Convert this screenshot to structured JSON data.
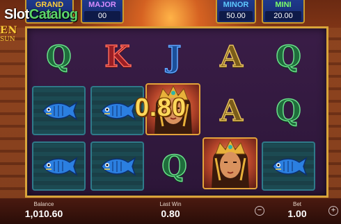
{
  "watermark": {
    "prefix": "Slot",
    "suffix": "Catalog"
  },
  "logo": {
    "line1": "EN",
    "line2": "SUN"
  },
  "jackpots": {
    "grand": {
      "name": "GRAND",
      "value": "00"
    },
    "major": {
      "name": "MAJOR",
      "value": "00"
    },
    "minor": {
      "name": "MINOR",
      "value": "50.00"
    },
    "mini": {
      "name": "MINI",
      "value": "20.00"
    }
  },
  "reels": {
    "row1": [
      "Q",
      "K",
      "J",
      "A",
      "Q"
    ],
    "row2_letters": [
      "A",
      "Q"
    ],
    "row3_letters": [
      "Q"
    ],
    "win_amount": "0.80"
  },
  "bottom": {
    "balance_label": "Balance",
    "balance_value": "1,010.60",
    "lastwin_label": "Last Win",
    "lastwin_value": "0.80",
    "bet_label": "Bet",
    "bet_value": "1.00",
    "minus": "−",
    "plus": "+"
  },
  "icons": {
    "fish": "fish-symbol-icon",
    "queen": "queen-symbol-icon",
    "minus": "minus-icon",
    "plus": "plus-icon"
  }
}
